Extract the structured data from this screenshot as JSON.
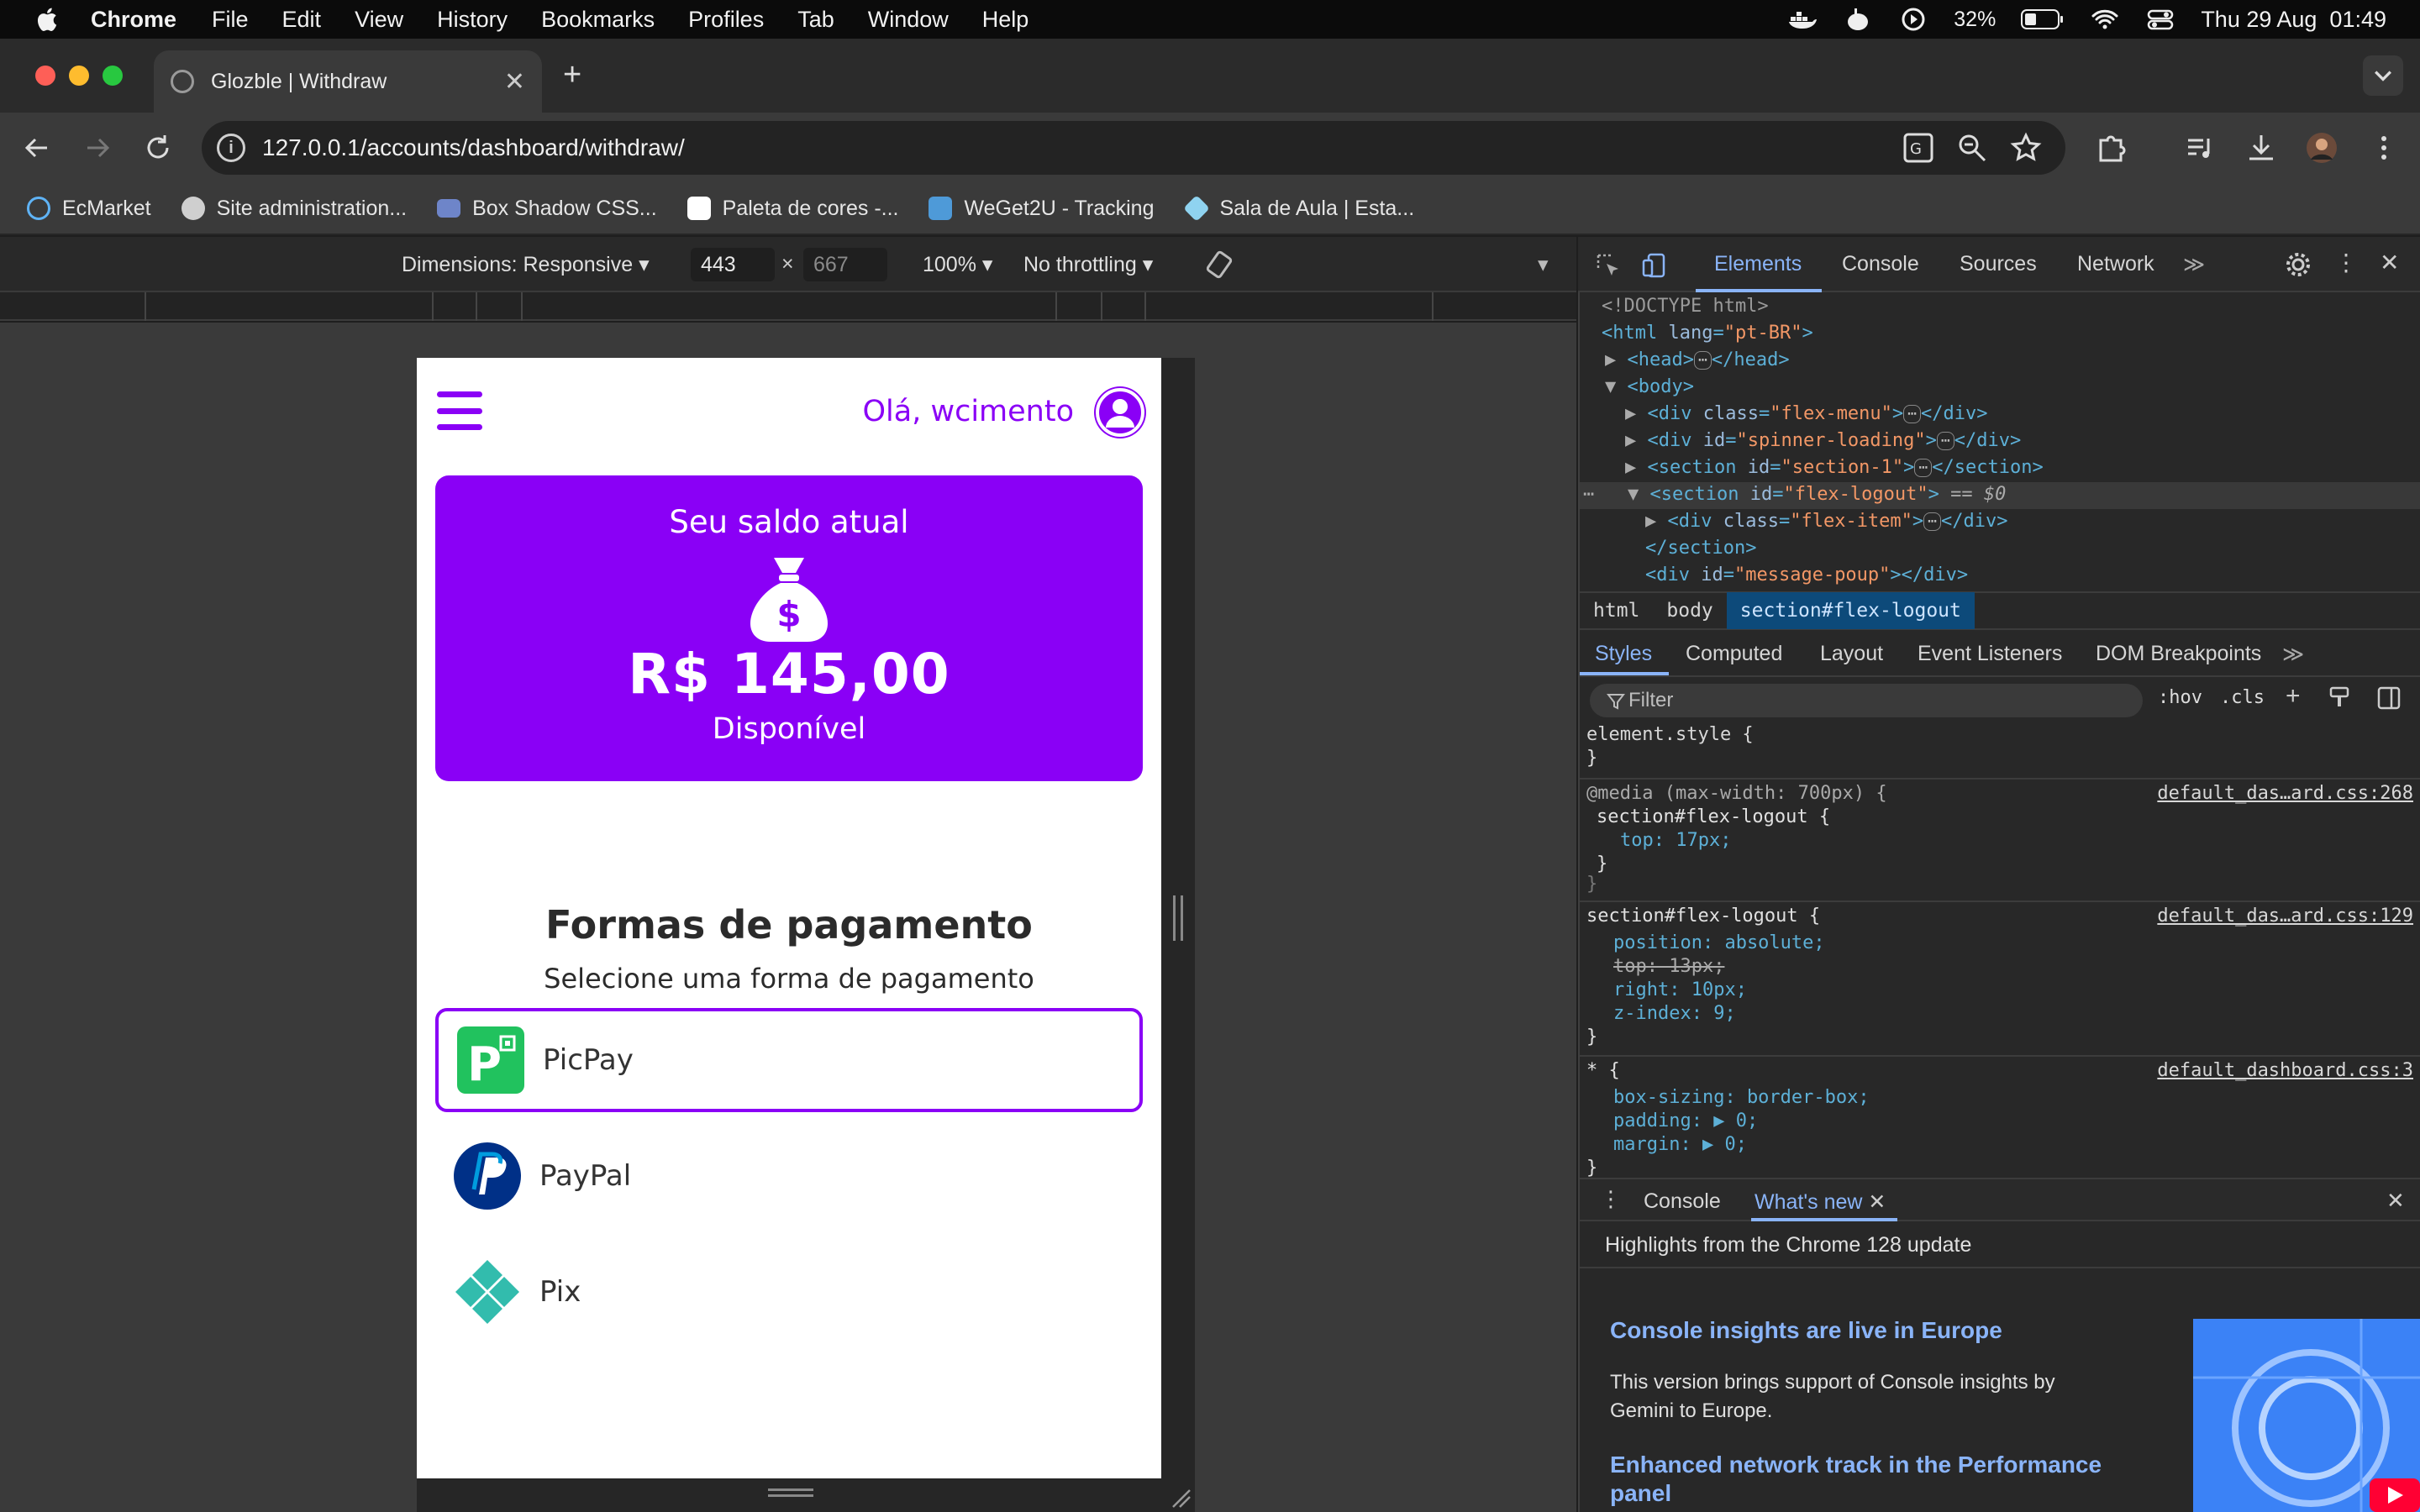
{
  "menubar": {
    "app": "Chrome",
    "items": [
      "File",
      "Edit",
      "View",
      "History",
      "Bookmarks",
      "Profiles",
      "Tab",
      "Window",
      "Help"
    ],
    "battery": "32%",
    "clock": "Thu 29 Aug  01:49"
  },
  "browser": {
    "tab_title": "Glozble | Withdraw",
    "url": "127.0.0.1/accounts/dashboard/withdraw/",
    "bookmarks": [
      {
        "label": "EcMarket",
        "color": "#5fb3f5"
      },
      {
        "label": "Site administration...",
        "color": "#cfcfcf"
      },
      {
        "label": "Box Shadow CSS...",
        "color": "#6e85c9"
      },
      {
        "label": "Paleta de cores -...",
        "color": "#ffffff"
      },
      {
        "label": "WeGet2U - Tracking",
        "color": "#4e9ad8"
      },
      {
        "label": "Sala de Aula | Esta...",
        "color": "#8fd3f0"
      }
    ]
  },
  "device_toolbar": {
    "dimensions": "Dimensions: Responsive",
    "width": "443",
    "height": "667",
    "zoom": "100%",
    "throttling": "No throttling"
  },
  "page": {
    "greeting": "Olá, wcimento",
    "balance_label": "Seu saldo atual",
    "balance_amount": "R$ 145,00",
    "balance_status": "Disponível",
    "payment_title": "Formas de pagamento",
    "payment_subtitle": "Selecione uma forma de pagamento",
    "payment_methods": [
      {
        "name": "PicPay",
        "selected": true
      },
      {
        "name": "PayPal",
        "selected": false
      },
      {
        "name": "Pix",
        "selected": false
      }
    ],
    "accent_color": "#8a00f6"
  },
  "devtools": {
    "tabs": [
      "Elements",
      "Console",
      "Sources",
      "Network"
    ],
    "dom": {
      "doctype": "<!DOCTYPE html>",
      "html_tag": "html",
      "html_attr": "lang",
      "html_lang": "\"pt-BR\"",
      "head": "head",
      "body": "body",
      "div_flex_menu": "\"flex-menu\"",
      "div_spinner": "\"spinner-loading\"",
      "section_1": "\"section-1\"",
      "section_logout": "\"flex-logout\"",
      "selected_marker": "== $0",
      "div_flex_item": "\"flex-item\"",
      "div_message": "\"message-poup\""
    },
    "breadcrumbs": [
      "html",
      "body",
      "section#flex-logout"
    ],
    "style_tabs": [
      "Styles",
      "Computed",
      "Layout",
      "Event Listeners",
      "DOM Breakpoints"
    ],
    "filter_placeholder": "Filter",
    "hov": ":hov",
    "cls": ".cls",
    "rules": {
      "element_style": "element.style {",
      "close": "}",
      "media": "@media (max-width: 700px) {",
      "media_selector": "section#flex-logout {",
      "media_prop": "top: 17px;",
      "media_src": "default_das…ard.css:268",
      "rule2_selector": "section#flex-logout {",
      "rule2_src": "default_das…ard.css:129",
      "rule2_p1": "position: absolute;",
      "rule2_p2": "top: 13px;",
      "rule2_p3": "right: 10px;",
      "rule2_p4": "z-index: 9;",
      "rule3_selector": "* {",
      "rule3_src": "default_dashboard.css:3",
      "rule3_p1": "box-sizing: border-box;",
      "rule3_p2": "padding: ▶ 0;",
      "rule3_p3": "margin: ▶ 0;"
    },
    "drawer_tabs": [
      "Console",
      "What's new"
    ],
    "whatsnew": {
      "highlight": "Highlights from the Chrome 128 update",
      "h1": "Console insights are live in Europe",
      "p1a": "This version brings support of Console insights by",
      "p1b": "Gemini to Europe.",
      "h2a": "Enhanced network track in the Performance",
      "h2b": "panel"
    }
  }
}
